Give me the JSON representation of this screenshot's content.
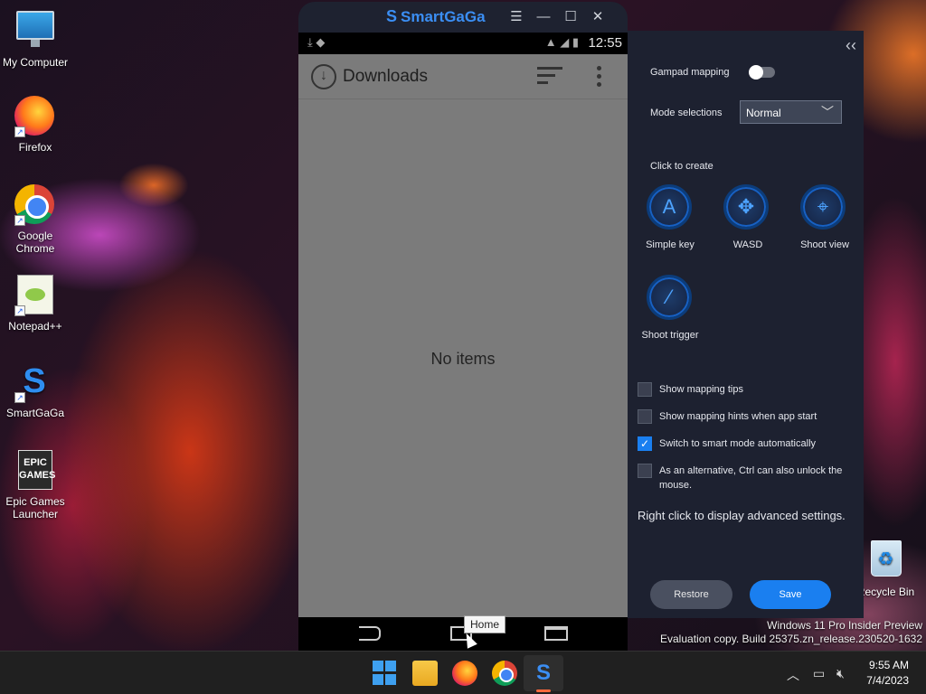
{
  "desktop": {
    "icons": [
      {
        "label": "My Computer",
        "icon": "monitor-icon"
      },
      {
        "label": "Firefox",
        "icon": "firefox-icon"
      },
      {
        "label": "Google Chrome",
        "icon": "chrome-icon"
      },
      {
        "label": "Notepad++",
        "icon": "notepadpp-icon"
      },
      {
        "label": "SmartGaGa",
        "icon": "smartgaga-icon"
      },
      {
        "label": "Epic Games Launcher",
        "icon": "epic-games-icon"
      },
      {
        "label": "Recycle Bin",
        "icon": "recycle-bin-icon"
      }
    ],
    "epic_logo_text": "EPIC GAMES",
    "watermark_line1": "Windows 11 Pro Insider Preview",
    "watermark_line2": "Evaluation copy. Build 25375.zn_release.230520-1632"
  },
  "emulator": {
    "title": "SmartGaGa",
    "statusbar": {
      "time": "12:55"
    },
    "app": {
      "title": "Downloads",
      "empty_text": "No items"
    },
    "nav_tooltip": "Home"
  },
  "panel": {
    "collapse_glyph": "‹‹",
    "gamepad_mapping_label": "Gampad mapping",
    "gamepad_mapping_on": false,
    "mode_label": "Mode selections",
    "mode_value": "Normal",
    "click_to_create_label": "Click to create",
    "create_items": [
      {
        "label": "Simple key",
        "glyph": "A"
      },
      {
        "label": "WASD",
        "glyph": "✥"
      },
      {
        "label": "Shoot view",
        "glyph": "⌖"
      },
      {
        "label": "Shoot trigger",
        "glyph": "⁄"
      }
    ],
    "options": [
      {
        "label": "Show mapping tips",
        "checked": false
      },
      {
        "label": "Show mapping hints when app start",
        "checked": false
      },
      {
        "label": "Switch to smart mode automatically",
        "checked": true
      },
      {
        "label": "As an alternative, Ctrl can also unlock the mouse.",
        "checked": false
      }
    ],
    "advanced_hint": "Right click to display advanced settings.",
    "restore_label": "Restore",
    "save_label": "Save"
  },
  "taskbar": {
    "clock_time": "9:55 AM",
    "clock_date": "7/4/2023"
  },
  "colors": {
    "accent": "#1a7ff0",
    "panel_bg": "#1d2130",
    "android_bg": "#7b7b7b"
  }
}
